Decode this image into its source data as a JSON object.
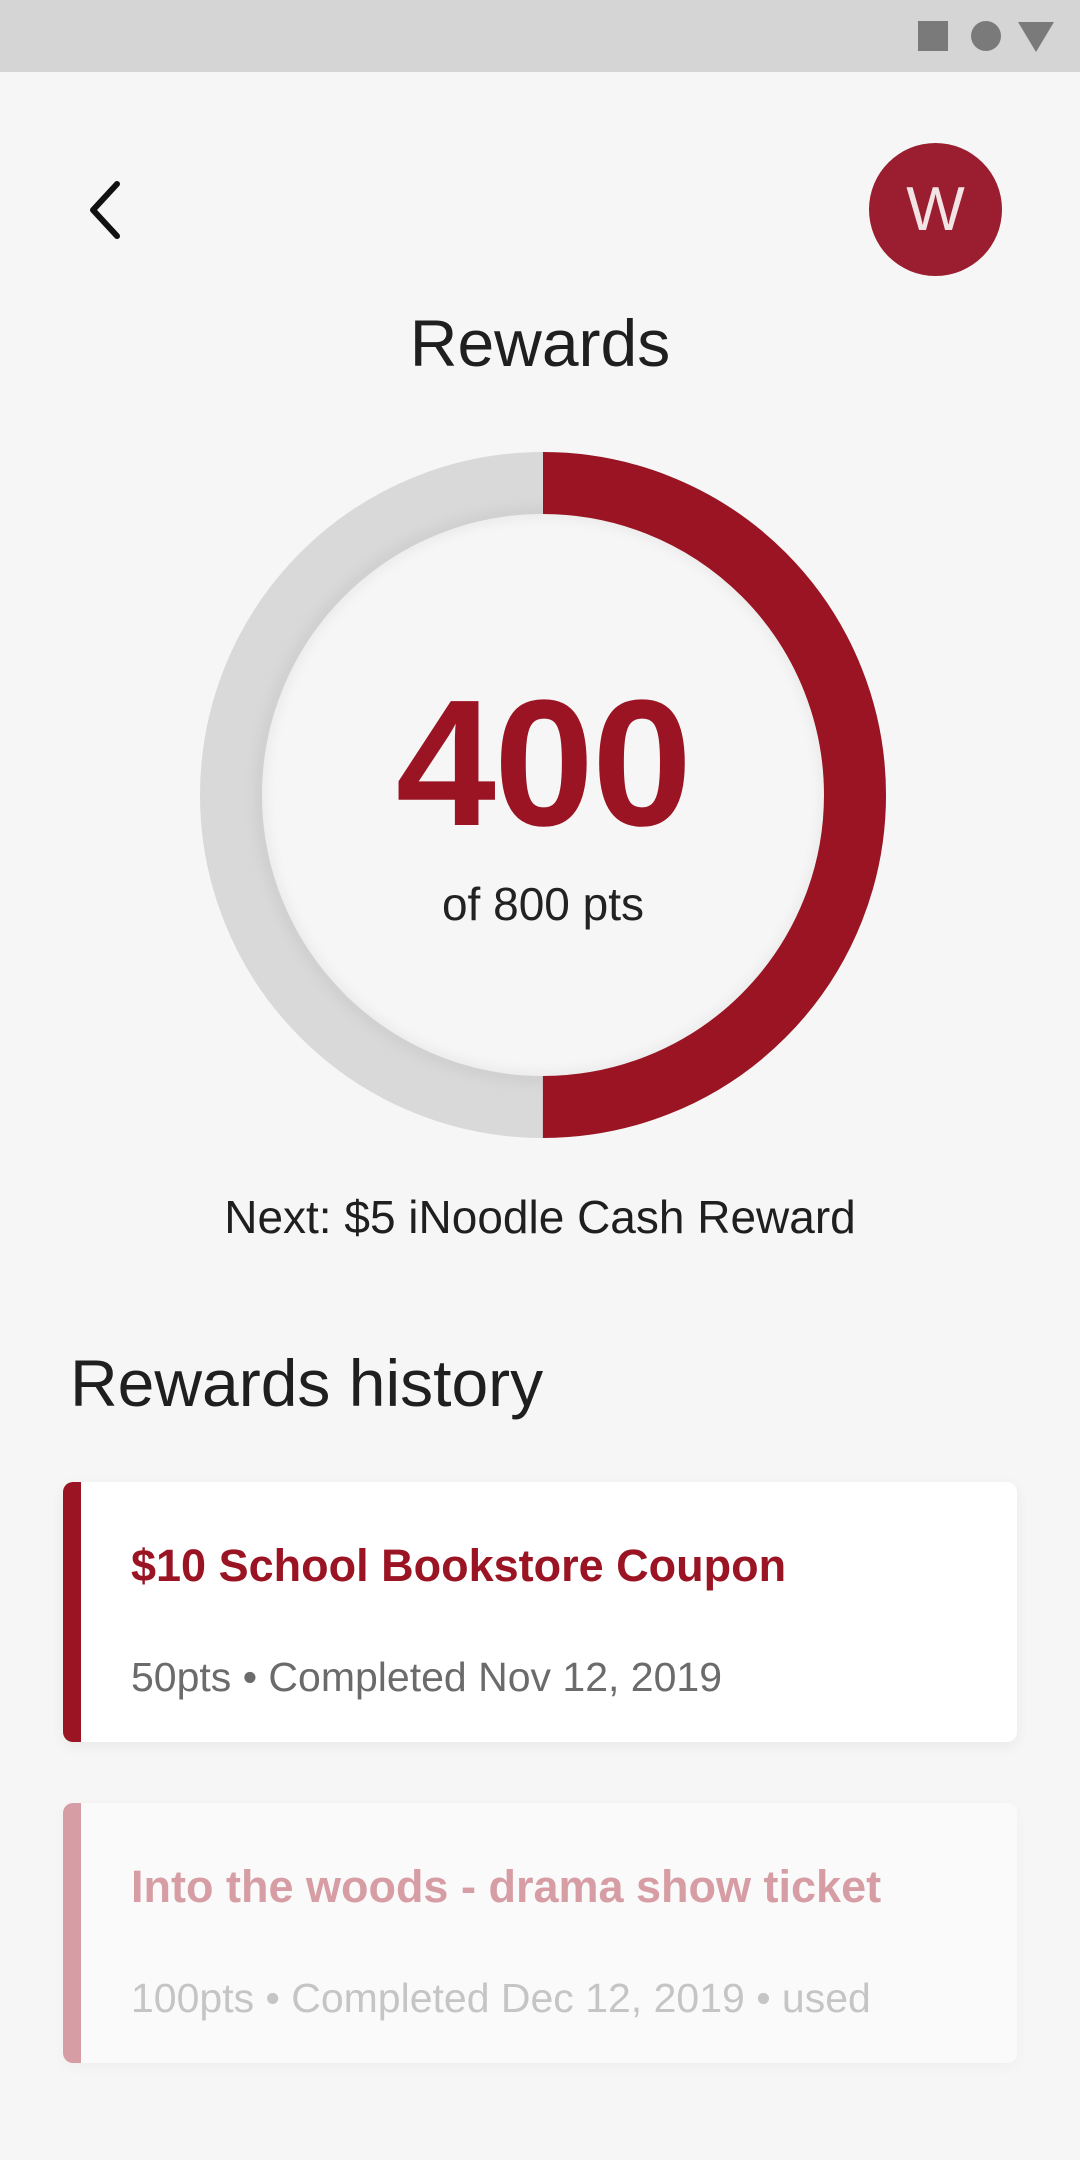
{
  "status_bar": {
    "icons": [
      "square-icon",
      "circle-icon",
      "triangle-icon"
    ]
  },
  "header": {
    "back_icon": "chevron-left-icon",
    "avatar_initial": "W",
    "title": "Rewards"
  },
  "progress": {
    "points": "400",
    "total_label": "of 800 pts",
    "fraction": 0.5,
    "next_reward": "Next: $5 iNoodle Cash Reward"
  },
  "history": {
    "heading": "Rewards history",
    "items": [
      {
        "title": "$10 School Bookstore Coupon",
        "meta": "50pts • Completed Nov 12, 2019"
      },
      {
        "title": "Into the woods - drama show ticket",
        "meta": "100pts • Completed Dec 12, 2019 • used"
      }
    ]
  },
  "colors": {
    "accent": "#9a1423",
    "accent_muted": "#d69ea4",
    "track": "#d9d9d9",
    "background": "#f6f6f6"
  }
}
